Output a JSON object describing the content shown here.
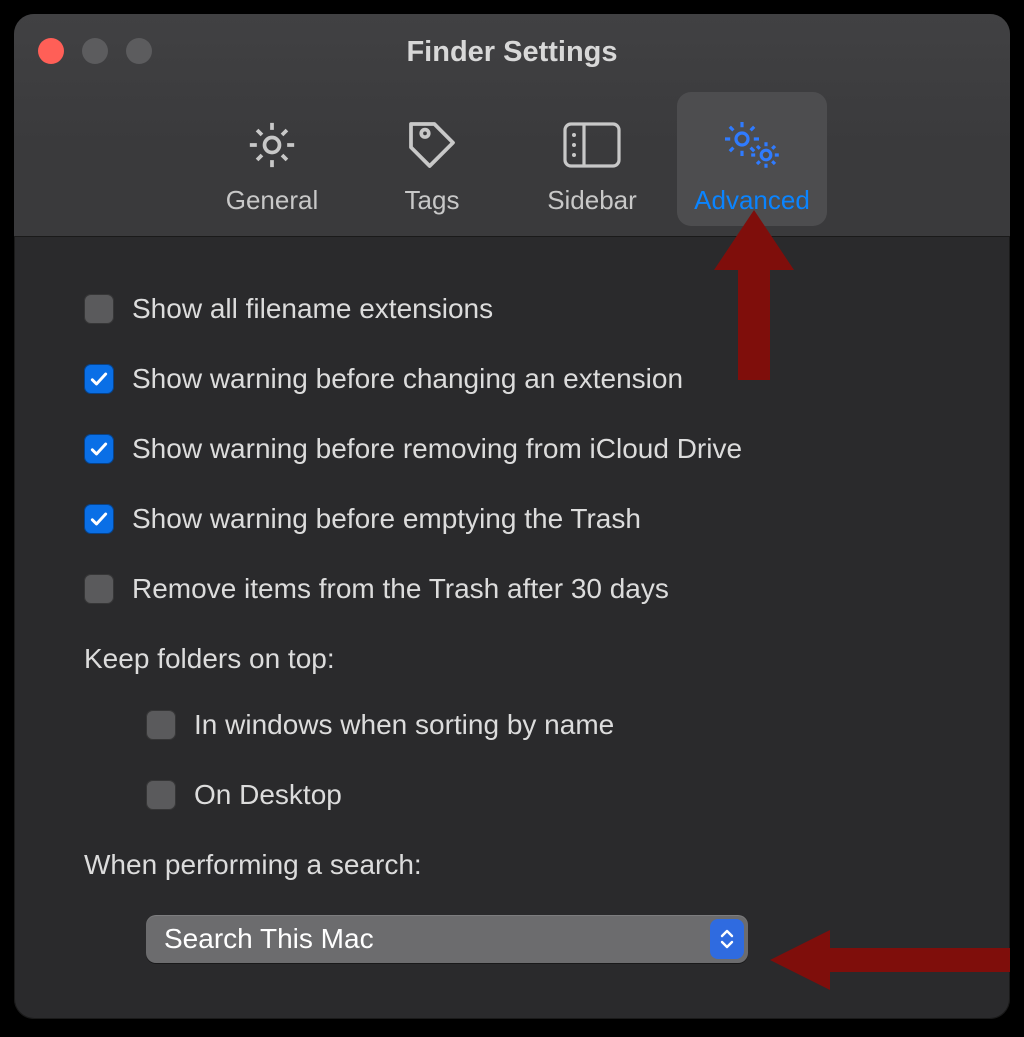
{
  "window": {
    "title": "Finder Settings"
  },
  "tabs": {
    "general": "General",
    "tags": "Tags",
    "sidebar": "Sidebar",
    "advanced": "Advanced",
    "active": "advanced"
  },
  "options": {
    "show_ext": {
      "label": "Show all filename extensions",
      "checked": false
    },
    "warn_ext": {
      "label": "Show warning before changing an extension",
      "checked": true
    },
    "warn_icloud": {
      "label": "Show warning before removing from iCloud Drive",
      "checked": true
    },
    "warn_trash": {
      "label": "Show warning before emptying the Trash",
      "checked": true
    },
    "trash_30": {
      "label": "Remove items from the Trash after 30 days",
      "checked": false
    },
    "keep_top_header": "Keep folders on top:",
    "keep_windows": {
      "label": "In windows when sorting by name",
      "checked": false
    },
    "keep_desktop": {
      "label": "On Desktop",
      "checked": false
    },
    "search_header": "When performing a search:",
    "search_value": "Search This Mac"
  }
}
